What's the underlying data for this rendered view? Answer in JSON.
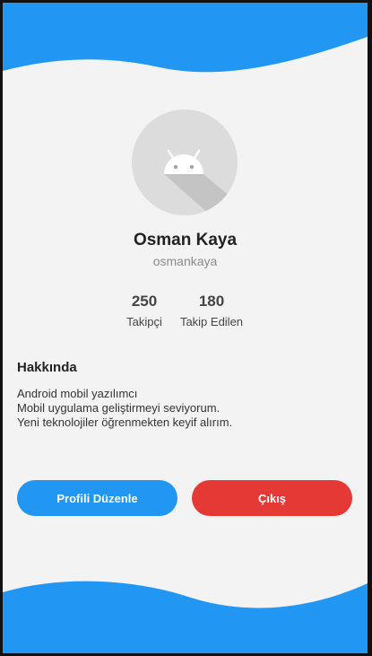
{
  "profile": {
    "name": "Osman Kaya",
    "username": "osmankaya"
  },
  "stats": {
    "followers_count": "250",
    "followers_label": "Takipçi",
    "following_count": "180",
    "following_label": "Takip Edilen"
  },
  "about": {
    "title": "Hakkında",
    "lines": [
      "Android mobil yazılımcı",
      "Mobil uygulama geliştirmeyi seviyorum.",
      "Yeni teknolojiler öğrenmekten keyif alırım."
    ]
  },
  "actions": {
    "edit_label": "Profili Düzenle",
    "logout_label": "Çıkış"
  },
  "colors": {
    "primary": "#2196F3",
    "danger": "#E53935",
    "background": "#F3F3F3"
  },
  "icons": {
    "avatar": "android-icon"
  }
}
